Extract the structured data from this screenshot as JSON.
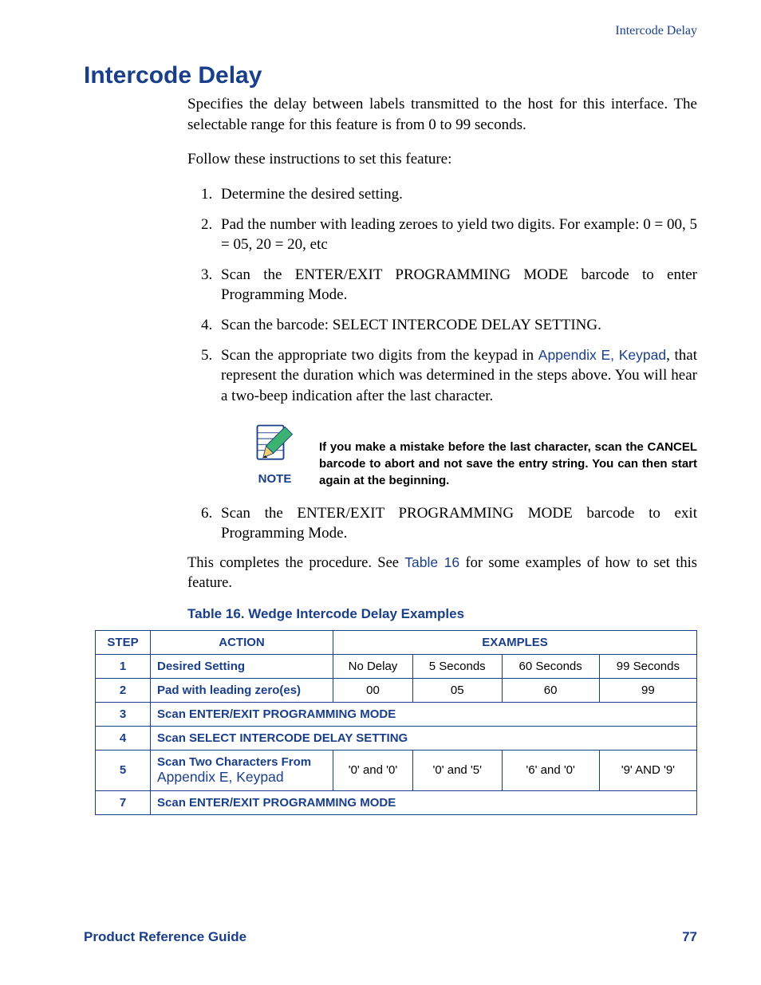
{
  "running_head": "Intercode Delay",
  "title": "Intercode Delay",
  "intro": "Specifies the delay between labels transmitted to the host for this interface. The selectable range for this feature is from 0 to 99 seconds.",
  "follow": "Follow these instructions to set this feature:",
  "steps": {
    "s1": "Determine the desired setting.",
    "s2": "Pad the number with leading zeroes to yield two digits. For example: 0 = 00, 5 = 05, 20 = 20, etc",
    "s3": "Scan the ENTER/EXIT PROGRAMMING MODE barcode to enter Programming Mode.",
    "s4": "Scan the barcode: SELECT INTERCODE DELAY SETTING.",
    "s5a": "Scan the appropriate two digits from the keypad in ",
    "s5link": "Appendix E, Keypad",
    "s5b": ", that represent the duration which was determined in the steps above. You will hear a two-beep indication after the last character.",
    "s6": "Scan the ENTER/EXIT PROGRAMMING MODE barcode to exit Programming Mode."
  },
  "note": {
    "label": "NOTE",
    "text": "If you make a mistake before the last character, scan the CANCEL barcode to abort and not save the entry string. You can then start again at the beginning."
  },
  "conclusion_a": "This completes the procedure. See ",
  "conclusion_link": "Table 16",
  "conclusion_b": " for some examples of how to set this feature.",
  "table_caption": "Table 16. Wedge Intercode Delay Examples",
  "table": {
    "headers": {
      "step": "STEP",
      "action": "ACTION",
      "examples": "EXAMPLES"
    },
    "rows": [
      {
        "step": "1",
        "action": "Desired Setting",
        "cells": [
          "No Delay",
          "5 Seconds",
          "60 Seconds",
          "99 Seconds"
        ]
      },
      {
        "step": "2",
        "action": "Pad with leading zero(es)",
        "cells": [
          "00",
          "05",
          "60",
          "99"
        ]
      },
      {
        "step": "3",
        "span": "Scan ENTER/EXIT PROGRAMMING MODE"
      },
      {
        "step": "4",
        "span": "Scan SELECT INTERCODE DELAY SETTING"
      },
      {
        "step": "5",
        "action_a": "Scan Two Characters From ",
        "action_link": "Appendix E, Keypad",
        "cells": [
          "'0' and '0'",
          "'0' and '5'",
          "'6' and '0'",
          "'9' AND '9'"
        ]
      },
      {
        "step": "7",
        "span": "Scan ENTER/EXIT PROGRAMMING MODE"
      }
    ]
  },
  "footer": {
    "left": "Product Reference Guide",
    "right": "77"
  }
}
